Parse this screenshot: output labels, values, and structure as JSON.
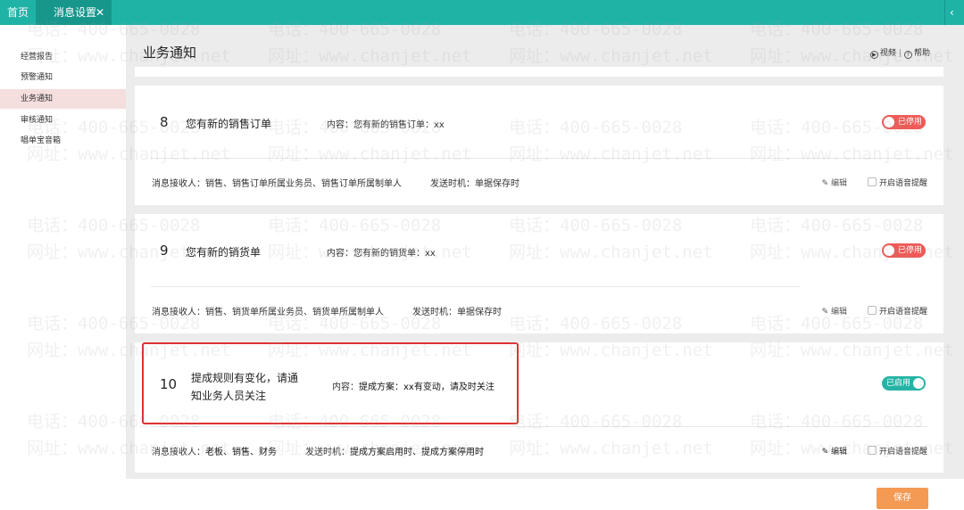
{
  "tabs": {
    "home": "首页",
    "active": "消息设置",
    "close_icon": "✕"
  },
  "sidebar": {
    "items": [
      {
        "label": "经营报告"
      },
      {
        "label": "预警通知"
      },
      {
        "label": "业务通知",
        "active": true
      },
      {
        "label": "审核通知"
      },
      {
        "label": "唱单宝音箱"
      }
    ]
  },
  "header": {
    "title": "业务通知",
    "video": "视频",
    "help": "帮助"
  },
  "cards": [
    {
      "num": "8",
      "title": "您有新的销售订单",
      "content": "内容：您有新的销售订单：xx",
      "receivers": "消息接收人：销售、销售订单所属业务员、销售订单所属制单人",
      "send_time": "发送时机：单据保存时",
      "status": "已停用",
      "edit": "编辑",
      "voice": "开启语音提醒"
    },
    {
      "num": "9",
      "title": "您有新的销货单",
      "content": "内容：您有新的销货单：xx",
      "receivers": "消息接收人：销售、销货单所属业务员、销货单所属制单人",
      "send_time": "发送时机：单据保存时",
      "status": "已停用",
      "edit": "编辑",
      "voice": "开启语音提醒"
    },
    {
      "num": "10",
      "title_line1": "提成规则有变化，请通",
      "title_line2": "知业务人员关注",
      "content_label": "内容：",
      "content_value": "提成方案：xx有变动，请及时关注",
      "receivers_label": "消息接收人：",
      "receivers_value": "老板、销售、财务",
      "send_time_label": "发送时机：",
      "send_time_value": "提成方案启用时、提成方案停用时",
      "status": "已启用",
      "edit": "编辑",
      "voice": "开启语音提醒"
    }
  ],
  "footer": {
    "save": "保存"
  },
  "watermark": {
    "phone": "电话：400-665-0028",
    "site": "网址：www.chanjet.net"
  },
  "colors": {
    "teal": "#1fb3a6",
    "red": "#ee5a56",
    "orange": "#f39a54",
    "highlight": "#e03030"
  }
}
